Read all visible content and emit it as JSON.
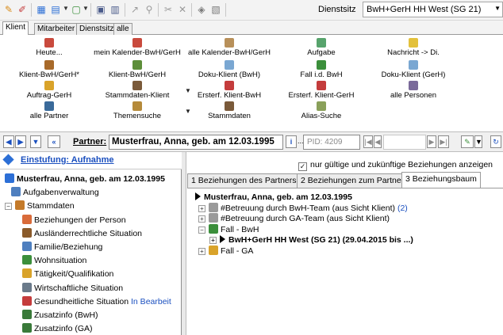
{
  "toolbar": {
    "office_label": "Dienstsitz",
    "office_value": "BwH+GerH HH West (SG 21)",
    "colors": {
      "bg": "#f3f3f3",
      "border": "#d9d9d9"
    },
    "icons": [
      "pen-icon",
      "pen-erase-icon",
      "calendar-icon",
      "calendar-drop-icon",
      "note-drop-icon",
      "save-icon",
      "document-icon",
      "print-icon",
      "attach-icon",
      "cut-icon",
      "copy-icon",
      "link-icon",
      "stamp-icon"
    ]
  },
  "tabs": {
    "items": [
      "Klient",
      "Mitarbeiter",
      "Dienstsitz",
      "alle"
    ],
    "active": "Klient"
  },
  "ribbon": {
    "rows": [
      [
        "Heute...",
        "mein Kalender-BwH/GerH",
        "alle Kalender-BwH/GerH",
        "Aufgabe",
        "Nachricht -> Di."
      ],
      [
        "Klient-BwH/GerH*",
        "Klient-BwH/GerH",
        "Doku-Klient (BwH)",
        "Fall i.d. BwH",
        "Doku-Klient (GerH)"
      ],
      [
        "Auftrag-GerH",
        "Stammdaten-Klient",
        "Ersterf. Klient-BwH",
        "Ersterf. Klient-GerH",
        "alle Personen"
      ],
      [
        "alle Partner",
        "Themensuche",
        "Stammdaten",
        "Alias-Suche",
        ""
      ]
    ],
    "icon_colors": [
      [
        "#c94a3d",
        "#c94a3d",
        "#b8905a",
        "#57a36c",
        "#e3c13b"
      ],
      [
        "#a86a2a",
        "#5d8e3a",
        "#7aa7d2",
        "#3b8f3b",
        "#7aa7d2"
      ],
      [
        "#d9a32a",
        "#7a5a3a",
        "#c43c3c",
        "#c43c3c",
        "#7a6a9a"
      ],
      [
        "#3a6a9a",
        "#b58a3a",
        "#7a5a3a",
        "#8aa05a",
        ""
      ]
    ]
  },
  "navbar": {
    "partner_label": "Partner:",
    "partner_value": "Musterfrau, Anna, geb. am 12.03.1995",
    "pid_placeholder": "PID: 4209",
    "info_label": "i",
    "more_label": "..."
  },
  "left": {
    "header": "Einstufung: Aufnahme",
    "tree": [
      {
        "label": "Musterfrau, Anna, geb. am 12.03.1995",
        "level": 0,
        "bold": true,
        "icon": "info-icon",
        "icon_color": "#2c6fd6"
      },
      {
        "label": "Aufgabenverwaltung",
        "level": 1,
        "icon": "task-list-icon",
        "icon_color": "#4e7fbf"
      },
      {
        "label": "Stammdaten",
        "level": 0,
        "expander": "−",
        "icon": "person-icon",
        "icon_color": "#c47a2a"
      },
      {
        "label": "Beziehungen der Person",
        "level": 2,
        "icon": "relations-icon",
        "icon_color": "#d96b3a",
        "selected": true
      },
      {
        "label": "Ausländerrechtliche Situation",
        "level": 2,
        "icon": "passport-icon",
        "icon_color": "#8a5a2a"
      },
      {
        "label": "Familie/Beziehung",
        "level": 2,
        "icon": "family-icon",
        "icon_color": "#4e7fbf"
      },
      {
        "label": "Wohnsituation",
        "level": 2,
        "icon": "house-icon",
        "icon_color": "#3b8f3b"
      },
      {
        "label": "Tätigkeit/Qualifikation",
        "level": 2,
        "icon": "work-icon",
        "icon_color": "#d9a32a"
      },
      {
        "label": "Wirtschaftliche Situation",
        "level": 2,
        "icon": "money-icon",
        "icon_color": "#6a7a8a"
      },
      {
        "label": "Gesundheitliche Situation",
        "level": 2,
        "status": "In Bearbeit",
        "icon": "health-icon",
        "icon_color": "#c43c3c"
      },
      {
        "label": "Zusatzinfo (BwH)",
        "level": 2,
        "icon": "info-person-icon",
        "icon_color": "#3a7a3a"
      },
      {
        "label": "Zusatzinfo (GA)",
        "level": 2,
        "icon": "info-person-icon",
        "icon_color": "#3a7a3a"
      }
    ]
  },
  "right": {
    "checkbox_label": "nur gültige und zukünftige Beziehungen anzeigen",
    "checkbox_checked": true,
    "tabs": [
      "1 Beziehungen des Partners",
      "2 Beziehungen zum Partner",
      "3 Beziehungsbaum"
    ],
    "active_tab": "3 Beziehungsbaum",
    "tree": [
      {
        "label": "Musterfrau, Anna, geb. am 12.03.1995",
        "level": 0,
        "bold": true,
        "arrow": true
      },
      {
        "label": "#Betreuung durch BwH-Team (aus Sicht Klient)",
        "count": "(2)",
        "level": 1,
        "expander": "+",
        "icon": "pen-relation-icon",
        "icon_color": "#9a9a9a"
      },
      {
        "label": "#Betreuung durch GA-Team (aus Sicht Klient)",
        "level": 1,
        "expander": "+",
        "icon": "pen-relation-icon",
        "icon_color": "#9a9a9a"
      },
      {
        "label": "Fall - BwH",
        "level": 1,
        "expander": "−",
        "icon": "folder-green-icon",
        "icon_color": "#3b8f3b"
      },
      {
        "label": "BwH+GerH HH West (SG 21) (29.04.2015 bis ...)",
        "level": 2,
        "expander": "+",
        "bold": true,
        "arrow": true
      },
      {
        "label": "Fall - GA",
        "level": 1,
        "expander": "+",
        "icon": "folder-yellow-icon",
        "icon_color": "#d9a32a"
      }
    ]
  }
}
